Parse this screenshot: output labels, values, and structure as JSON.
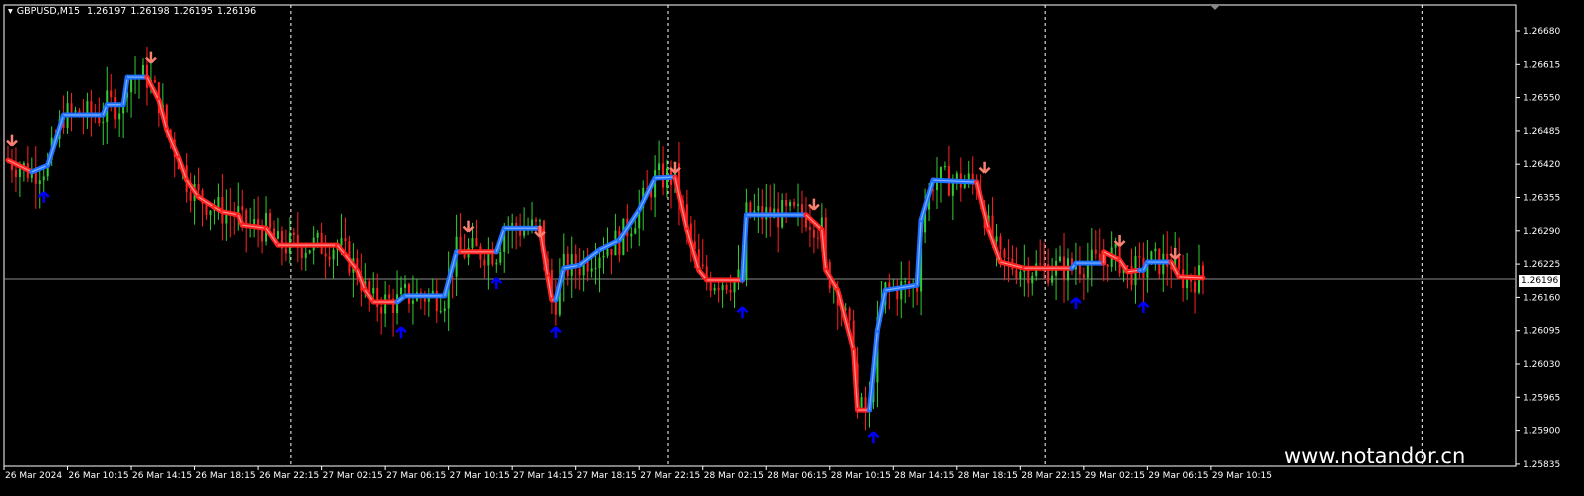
{
  "header": {
    "symbol": "GBPUSD,M15",
    "open": "1.26197",
    "high": "1.26198",
    "low": "1.26195",
    "close": "1.26196"
  },
  "watermark": "www.notandor.cn",
  "current_price_label": "1.26196",
  "colors": {
    "bull": "#32cd32",
    "bear": "#ff2020",
    "up_line": "#1e70ff",
    "down_line": "#ff2020",
    "arrow_up": "#0000ff",
    "arrow_down": "#fa8072",
    "grid": "#ffffff"
  },
  "chart_data": {
    "type": "candlestick",
    "symbol": "GBPUSD",
    "timeframe": "M15",
    "ylim": [
      1.2581,
      1.2673
    ],
    "y_ticks": [
      "1.26680",
      "1.26615",
      "1.26550",
      "1.26485",
      "1.26420",
      "1.26355",
      "1.26290",
      "1.26225",
      "1.26160",
      "1.26095",
      "1.26030",
      "1.25965",
      "1.25900",
      "1.25835"
    ],
    "x_ticks": [
      {
        "bar": 0,
        "label": "26 Mar 2024"
      },
      {
        "bar": 16,
        "label": "26 Mar 10:15"
      },
      {
        "bar": 32,
        "label": "26 Mar 14:15"
      },
      {
        "bar": 48,
        "label": "26 Mar 18:15"
      },
      {
        "bar": 64,
        "label": "26 Mar 22:15"
      },
      {
        "bar": 80,
        "label": "27 Mar 02:15"
      },
      {
        "bar": 96,
        "label": "27 Mar 06:15"
      },
      {
        "bar": 112,
        "label": "27 Mar 10:15"
      },
      {
        "bar": 128,
        "label": "27 Mar 14:15"
      },
      {
        "bar": 144,
        "label": "27 Mar 18:15"
      },
      {
        "bar": 160,
        "label": "27 Mar 22:15"
      },
      {
        "bar": 176,
        "label": "28 Mar 02:15"
      },
      {
        "bar": 192,
        "label": "28 Mar 06:15"
      },
      {
        "bar": 208,
        "label": "28 Mar 10:15"
      },
      {
        "bar": 224,
        "label": "28 Mar 14:15"
      },
      {
        "bar": 240,
        "label": "28 Mar 18:15"
      },
      {
        "bar": 256,
        "label": "28 Mar 22:15"
      },
      {
        "bar": 272,
        "label": "29 Mar 02:15"
      },
      {
        "bar": 288,
        "label": "29 Mar 06:15"
      },
      {
        "bar": 304,
        "label": "29 Mar 10:15"
      }
    ],
    "day_separators": [
      71,
      166,
      261,
      356
    ],
    "current_price": 1.26196,
    "total_bars": 302,
    "trend_line": [
      [
        0,
        1.26428,
        -1
      ],
      [
        6,
        1.26405,
        -1
      ],
      [
        6,
        1.26405,
        1
      ],
      [
        10,
        1.26418,
        1
      ],
      [
        14,
        1.26516,
        1
      ],
      [
        24,
        1.26516,
        1
      ],
      [
        25,
        1.26536,
        1
      ],
      [
        29,
        1.26536,
        1
      ],
      [
        30,
        1.2659,
        1
      ],
      [
        35,
        1.2659,
        1
      ],
      [
        35,
        1.2659,
        -1
      ],
      [
        38,
        1.26545,
        -1
      ],
      [
        40,
        1.26487,
        -1
      ],
      [
        43,
        1.26432,
        -1
      ],
      [
        45,
        1.26389,
        -1
      ],
      [
        48,
        1.26356,
        -1
      ],
      [
        52,
        1.26336,
        -1
      ],
      [
        54,
        1.26327,
        -1
      ],
      [
        58,
        1.26321,
        -1
      ],
      [
        59,
        1.26301,
        -1
      ],
      [
        65,
        1.26295,
        -1
      ],
      [
        68,
        1.26262,
        -1
      ],
      [
        83,
        1.26262,
        -1
      ],
      [
        85,
        1.26243,
        -1
      ],
      [
        88,
        1.26213,
        -1
      ],
      [
        90,
        1.26174,
        -1
      ],
      [
        92,
        1.26151,
        -1
      ],
      [
        98,
        1.26151,
        -1
      ],
      [
        98,
        1.26151,
        1
      ],
      [
        100,
        1.26163,
        1
      ],
      [
        110,
        1.26163,
        1
      ],
      [
        113,
        1.26249,
        1
      ],
      [
        114,
        1.26249,
        1
      ],
      [
        114,
        1.26249,
        -1
      ],
      [
        123,
        1.26249,
        -1
      ],
      [
        123,
        1.26249,
        1
      ],
      [
        125,
        1.26295,
        1
      ],
      [
        134,
        1.26295,
        1
      ],
      [
        134,
        1.26295,
        -1
      ],
      [
        136,
        1.262,
        -1
      ],
      [
        137,
        1.26155,
        -1
      ],
      [
        138,
        1.26155,
        -1
      ],
      [
        138,
        1.26155,
        1
      ],
      [
        140,
        1.26217,
        1
      ],
      [
        144,
        1.26223,
        1
      ],
      [
        149,
        1.26253,
        1
      ],
      [
        154,
        1.26272,
        1
      ],
      [
        159,
        1.26331,
        1
      ],
      [
        163,
        1.26393,
        1
      ],
      [
        168,
        1.26395,
        1
      ],
      [
        168,
        1.26395,
        -1
      ],
      [
        171,
        1.26292,
        -1
      ],
      [
        174,
        1.26213,
        -1
      ],
      [
        176,
        1.26194,
        -1
      ],
      [
        185,
        1.26194,
        -1
      ],
      [
        185,
        1.26194,
        1
      ],
      [
        186,
        1.26321,
        1
      ],
      [
        201,
        1.26321,
        1
      ],
      [
        201,
        1.26321,
        -1
      ],
      [
        205,
        1.26292,
        -1
      ],
      [
        206,
        1.26213,
        -1
      ],
      [
        209,
        1.26174,
        -1
      ],
      [
        213,
        1.26057,
        -1
      ],
      [
        214,
        1.2594,
        -1
      ],
      [
        217,
        1.2594,
        -1
      ],
      [
        217,
        1.2594,
        1
      ],
      [
        219,
        1.26096,
        1
      ],
      [
        221,
        1.26174,
        1
      ],
      [
        229,
        1.26184,
        1
      ],
      [
        230,
        1.26311,
        1
      ],
      [
        233,
        1.26389,
        1
      ],
      [
        244,
        1.26385,
        1
      ],
      [
        244,
        1.26385,
        -1
      ],
      [
        247,
        1.26292,
        -1
      ],
      [
        250,
        1.26229,
        -1
      ],
      [
        256,
        1.26217,
        -1
      ],
      [
        268,
        1.26217,
        -1
      ],
      [
        268,
        1.26217,
        1
      ],
      [
        269,
        1.26227,
        1
      ],
      [
        276,
        1.26227,
        1
      ],
      [
        276,
        1.26249,
        -1
      ],
      [
        280,
        1.26233,
        -1
      ],
      [
        282,
        1.2621,
        -1
      ],
      [
        285,
        1.26213,
        -1
      ],
      [
        286,
        1.26213,
        1
      ],
      [
        287,
        1.26229,
        1
      ],
      [
        293,
        1.26229,
        1
      ],
      [
        293,
        1.26229,
        -1
      ],
      [
        295,
        1.262,
        -1
      ],
      [
        301,
        1.26198,
        -1
      ]
    ],
    "arrows": [
      {
        "bar": 1,
        "price": 1.26468,
        "dir": "down"
      },
      {
        "bar": 36,
        "price": 1.2663,
        "dir": "down"
      },
      {
        "bar": 116,
        "price": 1.263,
        "dir": "down"
      },
      {
        "bar": 134,
        "price": 1.2629,
        "dir": "down"
      },
      {
        "bar": 168,
        "price": 1.26415,
        "dir": "down"
      },
      {
        "bar": 203,
        "price": 1.26343,
        "dir": "down"
      },
      {
        "bar": 246,
        "price": 1.26415,
        "dir": "down"
      },
      {
        "bar": 280,
        "price": 1.26272,
        "dir": "down"
      },
      {
        "bar": 294,
        "price": 1.26247,
        "dir": "down"
      },
      {
        "bar": 9,
        "price": 1.26354,
        "dir": "up"
      },
      {
        "bar": 99,
        "price": 1.2609,
        "dir": "up"
      },
      {
        "bar": 123,
        "price": 1.26186,
        "dir": "up"
      },
      {
        "bar": 138,
        "price": 1.2609,
        "dir": "up"
      },
      {
        "bar": 185,
        "price": 1.26129,
        "dir": "up"
      },
      {
        "bar": 218,
        "price": 1.25885,
        "dir": "up"
      },
      {
        "bar": 269,
        "price": 1.26147,
        "dir": "up"
      },
      {
        "bar": 286,
        "price": 1.26139,
        "dir": "up"
      }
    ]
  }
}
